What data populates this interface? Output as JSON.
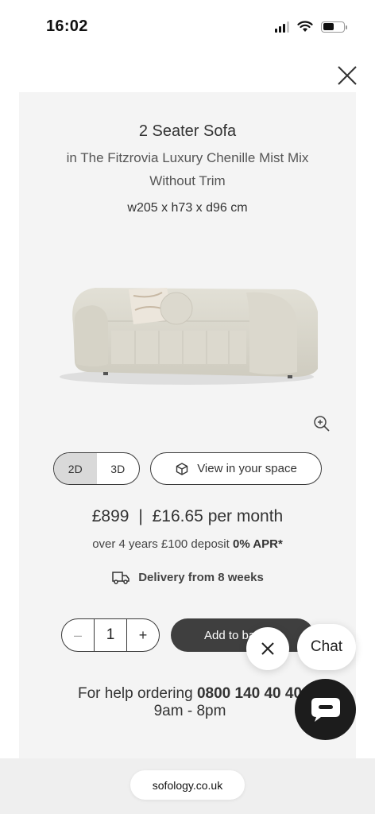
{
  "status_bar": {
    "time": "16:02"
  },
  "product": {
    "title": "2 Seater Sofa",
    "subtitle": "in The Fitzrovia Luxury Chenille Mist Mix Without Trim",
    "dimensions": "w205 x h73 x d96 cm"
  },
  "view_toggle": {
    "options": [
      "2D",
      "3D"
    ],
    "selected": "2D"
  },
  "ar_button": {
    "label": "View in your space"
  },
  "pricing": {
    "price": "£899",
    "separator": "|",
    "monthly": "£16.65 per month",
    "finance_text": "over 4 years £100 deposit",
    "apr": "0% APR*"
  },
  "delivery": {
    "text": "Delivery from 8 weeks"
  },
  "quantity": {
    "minus": "–",
    "value": "1",
    "plus": "+"
  },
  "add_to_basket": {
    "label": "Add to basket"
  },
  "help": {
    "prefix": "For help ordering",
    "phone": "0800 140 40 40",
    "hours": "9am - 8pm"
  },
  "chat": {
    "label": "Chat"
  },
  "browser": {
    "url": "sofology.co.uk"
  },
  "colors": {
    "card_bg": "#f4f4f4",
    "button_dark": "#3f3f3f",
    "chat_dark": "#1c1c1c"
  }
}
